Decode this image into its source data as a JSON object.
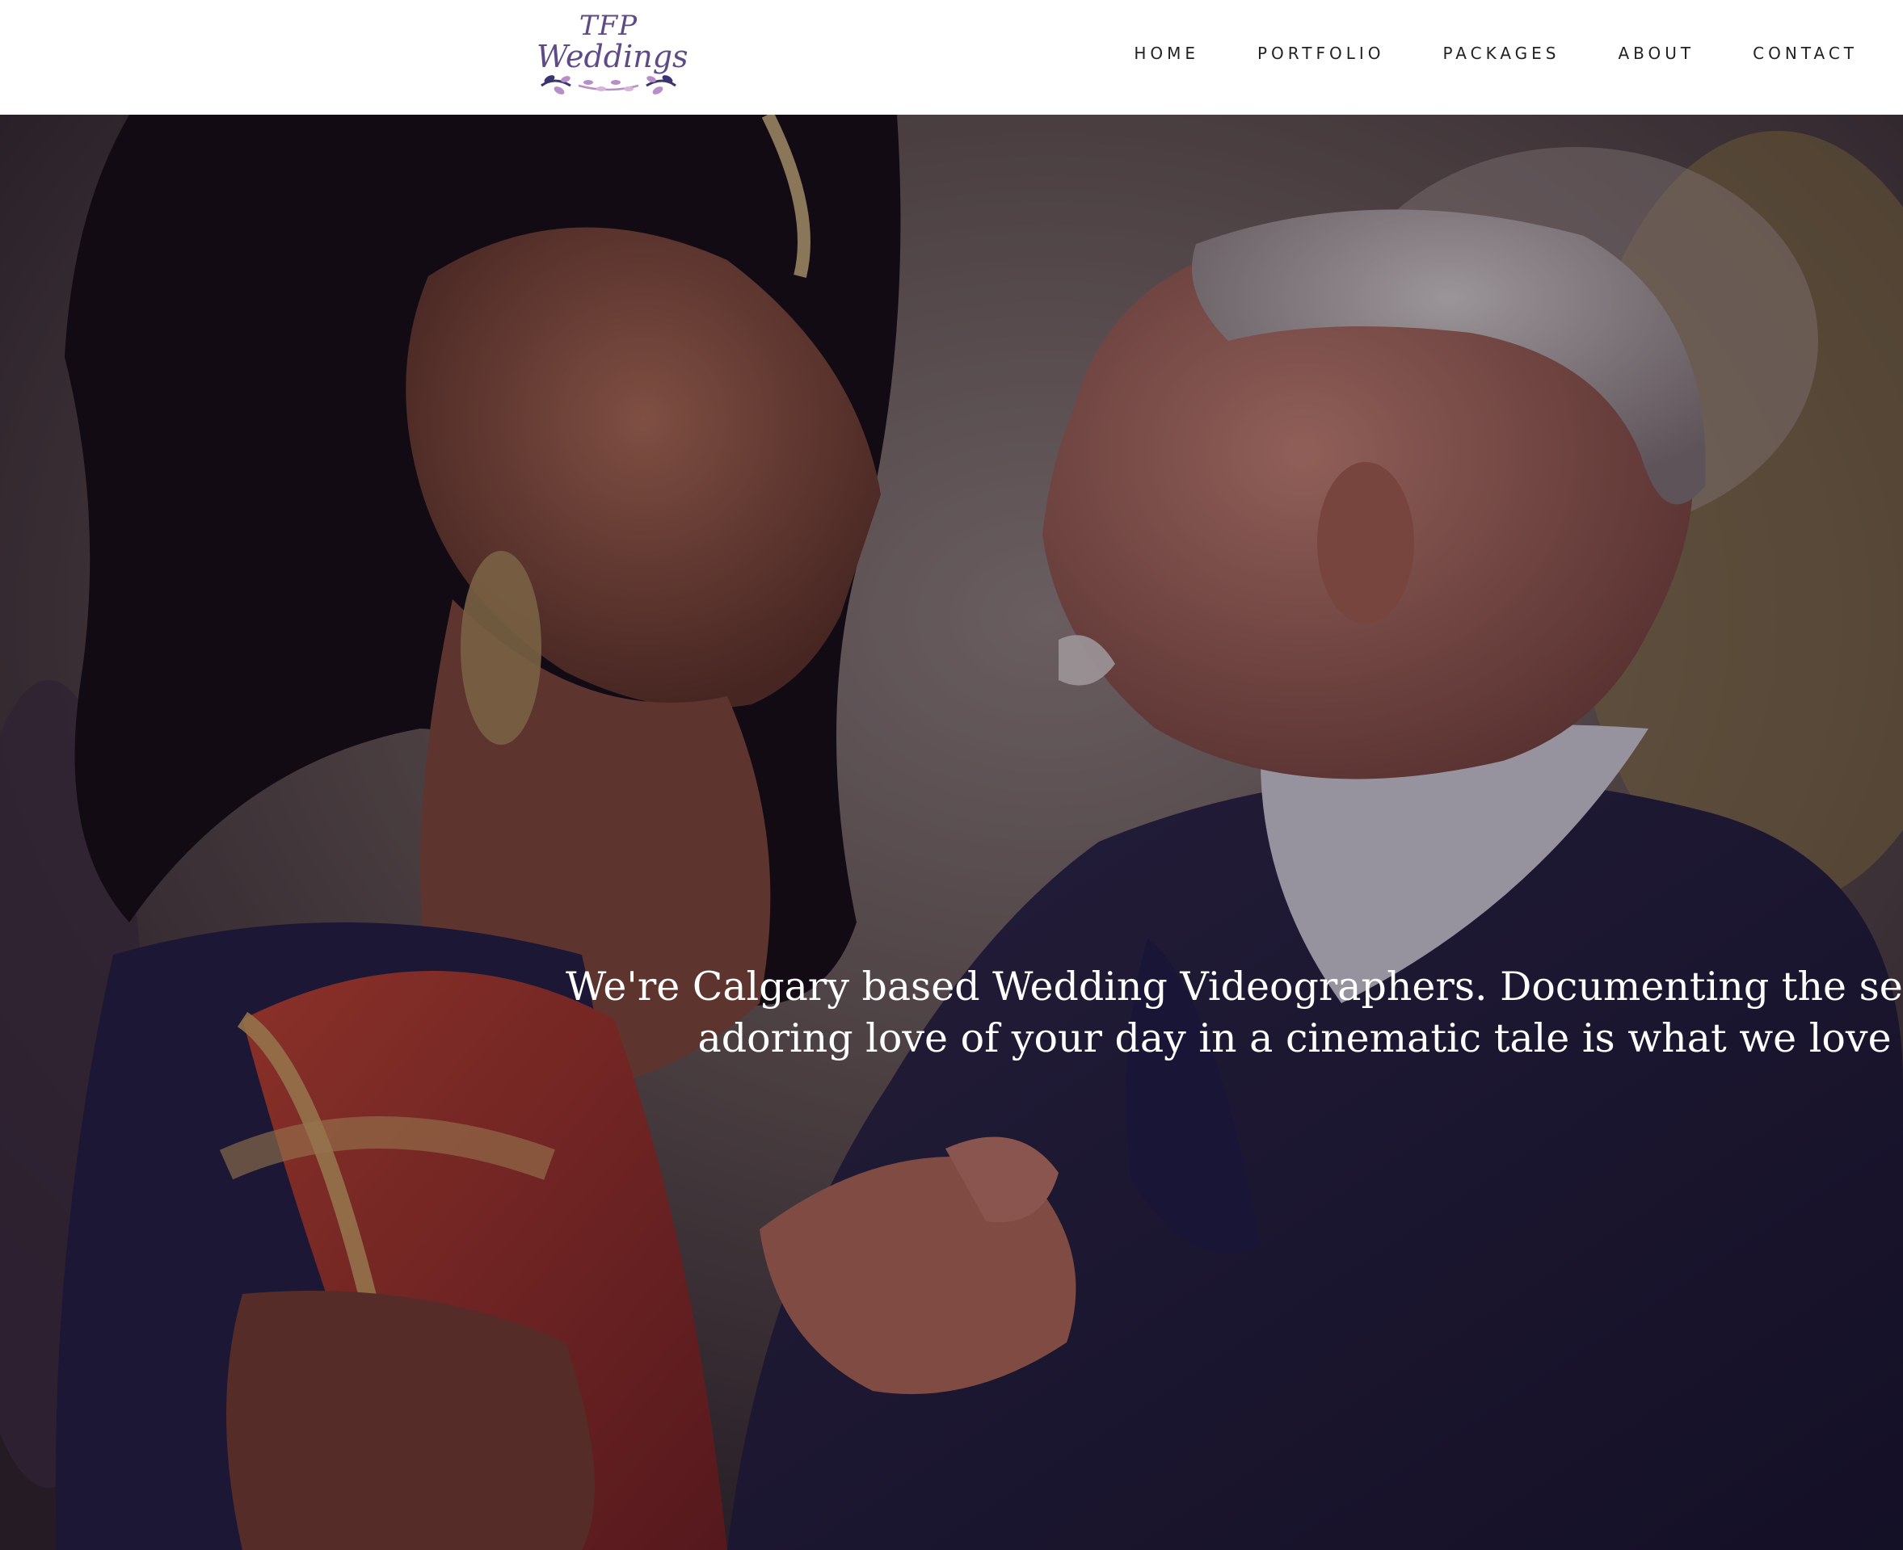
{
  "header": {
    "logo": {
      "top": "TFP",
      "main": "Weddings",
      "colors": {
        "text": "#5e4a86",
        "leaf_dark": "#3a3470",
        "leaf_light": "#b88ec6"
      }
    },
    "nav": [
      {
        "label": "HOME"
      },
      {
        "label": "PORTFOLIO"
      },
      {
        "label": "PACKAGES"
      },
      {
        "label": "ABOUT"
      },
      {
        "label": "CONTACT"
      }
    ]
  },
  "hero": {
    "image": "couple-dancing-photo",
    "caption_line1": "We're Calgary based Wedding Videographers. Documenting the serious, the silly and the",
    "caption_line2": "adoring love of your day in a cinematic tale is what we love to do."
  }
}
